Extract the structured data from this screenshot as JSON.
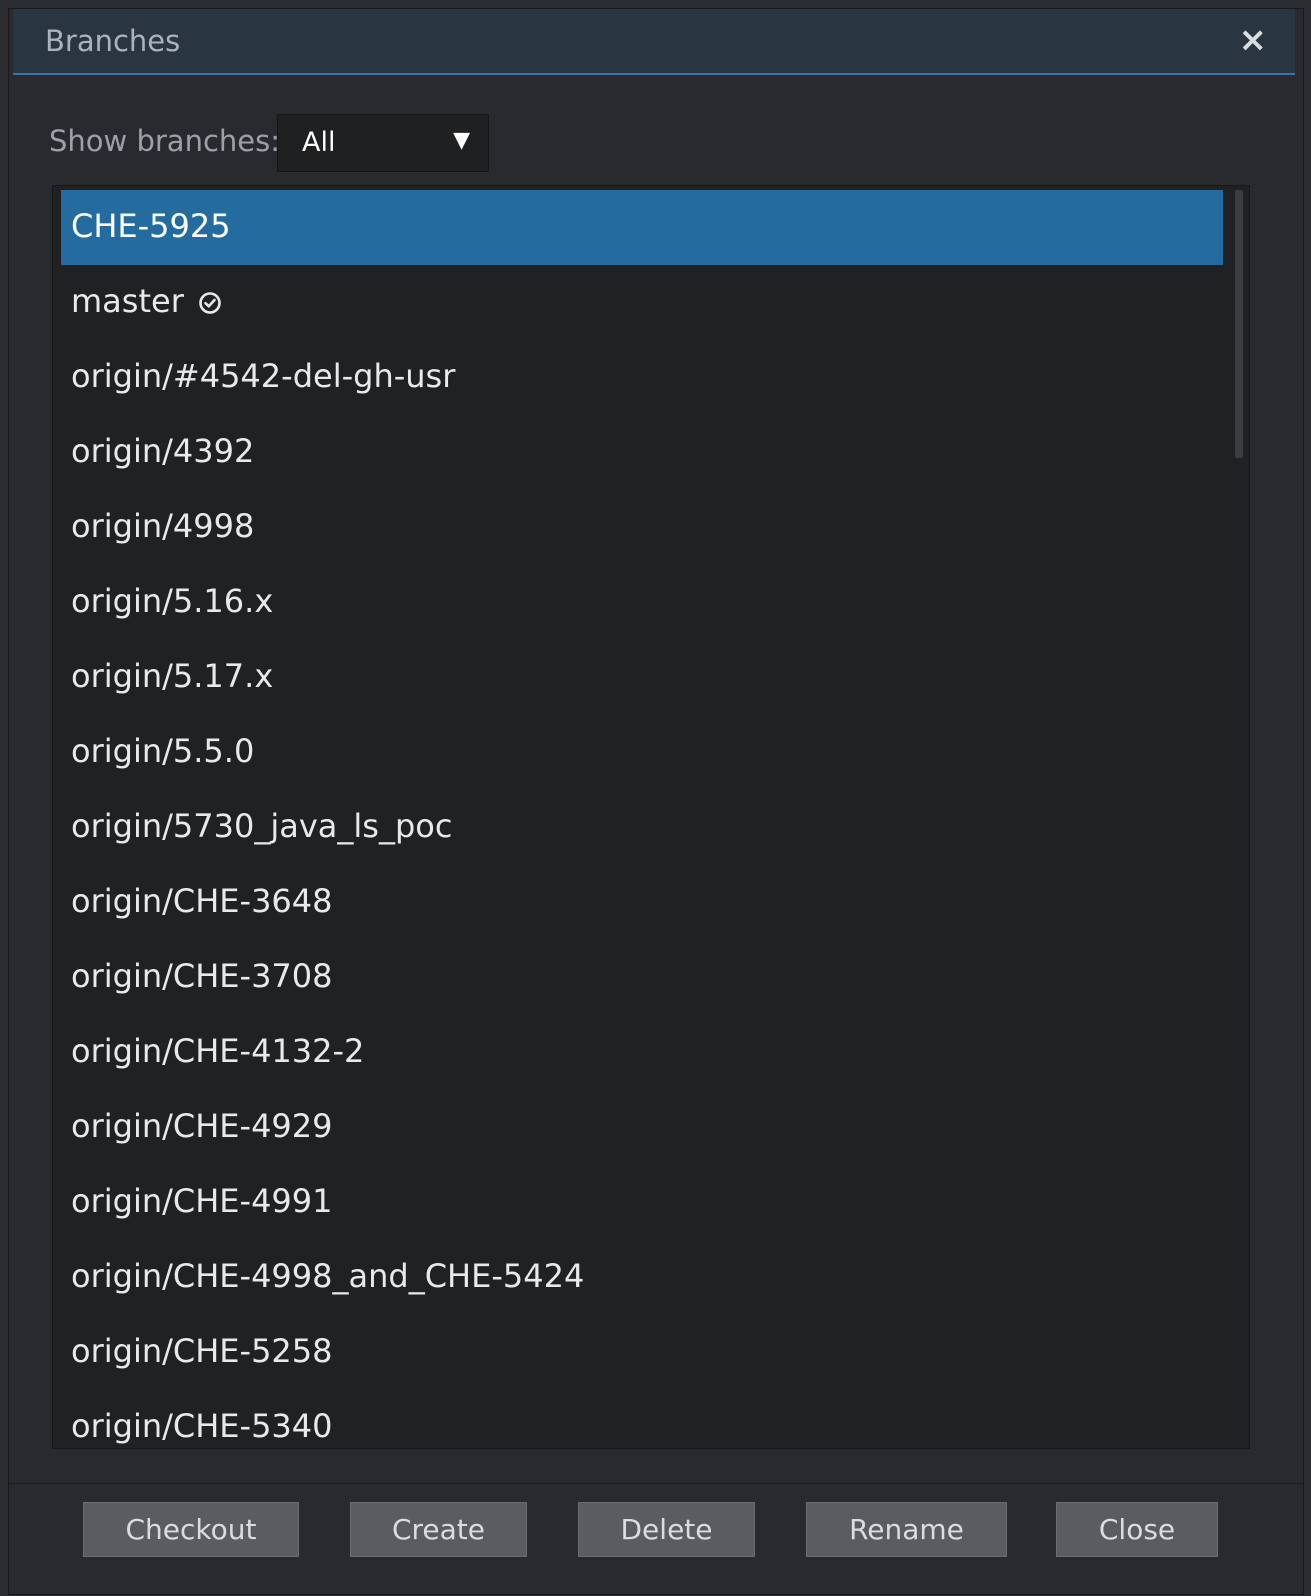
{
  "dialog": {
    "title": "Branches",
    "close_icon": "×"
  },
  "filter": {
    "label": "Show branches:",
    "selected": "All",
    "arrow": "▼"
  },
  "branches": [
    {
      "name": "CHE-5925",
      "selected": true,
      "current": false
    },
    {
      "name": "master",
      "selected": false,
      "current": true
    },
    {
      "name": "origin/#4542-del-gh-usr",
      "selected": false,
      "current": false
    },
    {
      "name": "origin/4392",
      "selected": false,
      "current": false
    },
    {
      "name": "origin/4998",
      "selected": false,
      "current": false
    },
    {
      "name": "origin/5.16.x",
      "selected": false,
      "current": false
    },
    {
      "name": "origin/5.17.x",
      "selected": false,
      "current": false
    },
    {
      "name": "origin/5.5.0",
      "selected": false,
      "current": false
    },
    {
      "name": "origin/5730_java_ls_poc",
      "selected": false,
      "current": false
    },
    {
      "name": "origin/CHE-3648",
      "selected": false,
      "current": false
    },
    {
      "name": "origin/CHE-3708",
      "selected": false,
      "current": false
    },
    {
      "name": "origin/CHE-4132-2",
      "selected": false,
      "current": false
    },
    {
      "name": "origin/CHE-4929",
      "selected": false,
      "current": false
    },
    {
      "name": "origin/CHE-4991",
      "selected": false,
      "current": false
    },
    {
      "name": "origin/CHE-4998_and_CHE-5424",
      "selected": false,
      "current": false
    },
    {
      "name": "origin/CHE-5258",
      "selected": false,
      "current": false
    },
    {
      "name": "origin/CHE-5340",
      "selected": false,
      "current": false
    }
  ],
  "buttons": {
    "checkout": "Checkout",
    "create": "Create",
    "delete": "Delete",
    "rename": "Rename",
    "close": "Close"
  },
  "colors": {
    "accent": "#2c78b8",
    "selection": "#246ca0",
    "background": "#292a2d",
    "list_background": "#202123",
    "button": "#5a5c60"
  }
}
